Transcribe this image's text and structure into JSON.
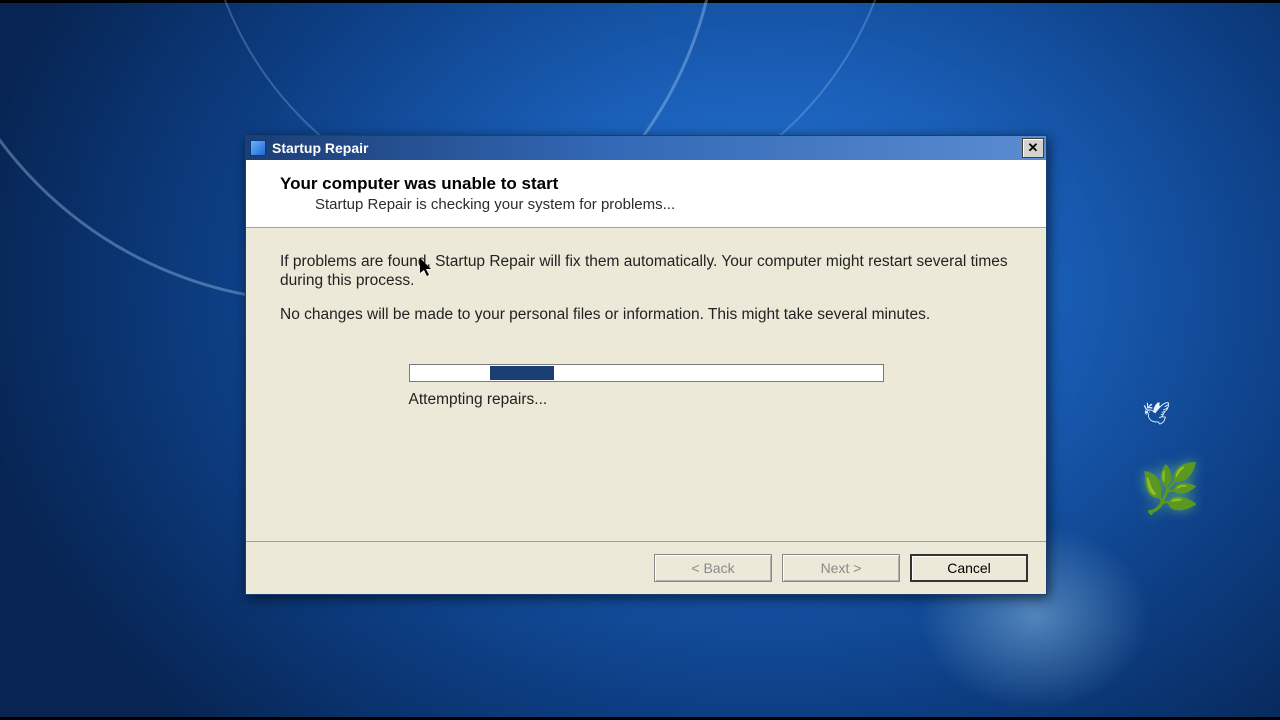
{
  "window": {
    "title": "Startup Repair"
  },
  "header": {
    "title": "Your computer was unable to start",
    "subtitle": "Startup Repair is checking your system for problems..."
  },
  "body": {
    "p1": "If problems are found, Startup Repair will fix them automatically. Your computer might restart several times during this process.",
    "p2": "No changes will be made to your personal files or information. This might take several minutes."
  },
  "progress": {
    "label": "Attempting repairs..."
  },
  "buttons": {
    "back": "<  Back",
    "next": "Next  >",
    "cancel": "Cancel"
  }
}
